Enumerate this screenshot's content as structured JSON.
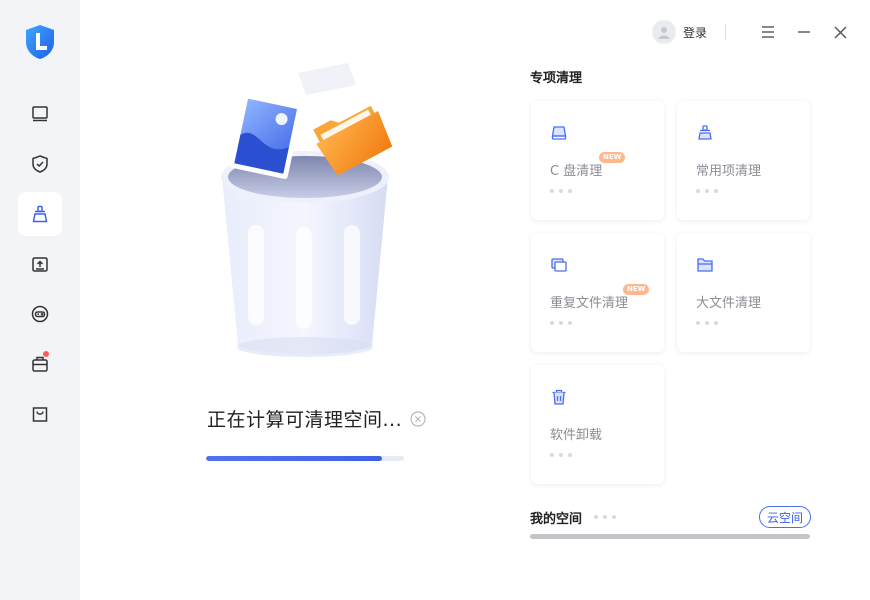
{
  "header": {
    "login_label": "登录"
  },
  "sidebar": {
    "items": [
      {
        "name": "monitor-icon"
      },
      {
        "name": "shield-check-icon"
      },
      {
        "name": "broom-icon"
      },
      {
        "name": "drive-upload-icon"
      },
      {
        "name": "controller-icon"
      },
      {
        "name": "toolbox-icon",
        "badge": true
      },
      {
        "name": "shopping-bag-icon"
      }
    ],
    "active_index": 2
  },
  "scan": {
    "status_text": "正在计算可清理空间...",
    "progress": 0.89
  },
  "special_clean": {
    "title": "专项清理",
    "cards": [
      {
        "label": "C 盘清理",
        "icon": "drive-icon",
        "new": true
      },
      {
        "label": "常用项清理",
        "icon": "broom-icon",
        "new": false
      },
      {
        "label": "重复文件清理",
        "icon": "duplicate-files-icon",
        "new": true
      },
      {
        "label": "大文件清理",
        "icon": "folder-icon",
        "new": false
      },
      {
        "label": "软件卸载",
        "icon": "trash-icon",
        "new": false
      }
    ],
    "new_badge_text": "NEW"
  },
  "my_space": {
    "title": "我的空间",
    "cloud_button_label": "云空间"
  },
  "colors": {
    "accent": "#3c62e8",
    "sidebar_bg": "#f3f4f7",
    "badge_new": "#fdb98d"
  }
}
